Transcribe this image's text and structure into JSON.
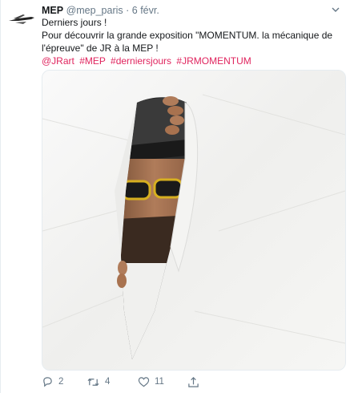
{
  "tweet": {
    "author_name": "MEP",
    "author_handle": "@mep_paris",
    "separator": "·",
    "timestamp": "6 févr.",
    "line1": "Derniers jours !",
    "line2": "Pour découvrir la grande exposition \"MOMENTUM. la mécanique de l'épreuve\" de JR à la MEP !",
    "hashtags": [
      "@JRart",
      "#MEP",
      "#derniersjours",
      "#JRMOMENTUM"
    ],
    "media_description": "Man in hat and yellow-rimmed sunglasses peeking through a torn white paper",
    "actions": {
      "reply_count": "2",
      "retweet_count": "4",
      "like_count": "11"
    }
  },
  "colors": {
    "hashtag": "#e0245e",
    "secondary_text": "#657786",
    "primary_text": "#14171a"
  },
  "icons": [
    "logo-icon",
    "chevron-down-icon",
    "reply-icon",
    "retweet-icon",
    "like-icon",
    "share-icon"
  ]
}
